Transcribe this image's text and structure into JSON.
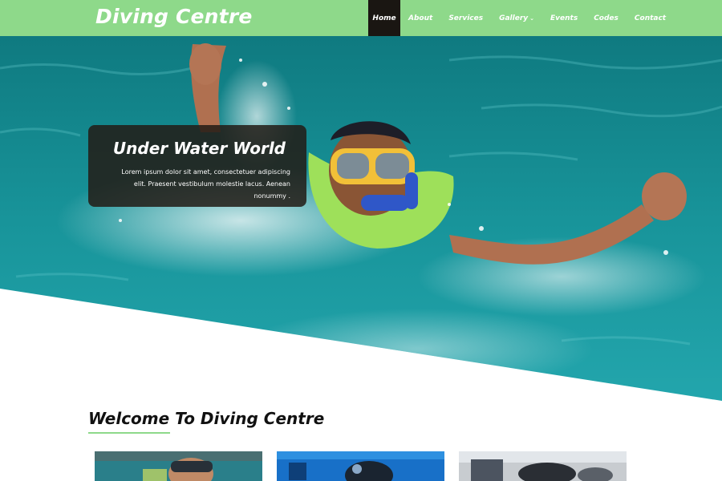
{
  "brand": {
    "title": "Diving Centre"
  },
  "nav": {
    "items": [
      {
        "label": "Home",
        "active": true,
        "has_dropdown": false
      },
      {
        "label": "About",
        "active": false,
        "has_dropdown": false
      },
      {
        "label": "Services",
        "active": false,
        "has_dropdown": false
      },
      {
        "label": "Gallery",
        "active": false,
        "has_dropdown": true
      },
      {
        "label": "Events",
        "active": false,
        "has_dropdown": false
      },
      {
        "label": "Codes",
        "active": false,
        "has_dropdown": false
      },
      {
        "label": "Contact",
        "active": false,
        "has_dropdown": false
      }
    ],
    "dropdown_caret": "⌄"
  },
  "hero": {
    "image": "swimmer-with-diving-mask-in-pool",
    "caption_title": "Under Water World",
    "caption_text": "Lorem ipsum dolor sit amet, consectetuer adipiscing elit. Praesent vestibulum molestie lacus. Aenean nonummy ."
  },
  "welcome": {
    "title": "Welcome To Diving Centre",
    "thumbnails": [
      {
        "image": "diver-with-mask-in-water"
      },
      {
        "image": "scuba-diver-underwater-blue"
      },
      {
        "image": "diving-gear-on-boat"
      }
    ]
  },
  "colors": {
    "header_bg": "#8ed98a",
    "active_nav_bg": "#1a1612",
    "caption_bg": "#231c16",
    "water": "#1a8f92",
    "accent_underline": "#8ed98a"
  }
}
